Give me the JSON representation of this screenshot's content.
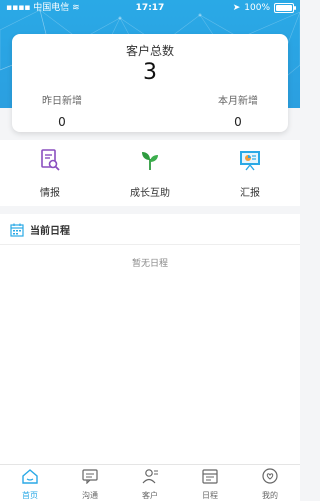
{
  "status_bar": {
    "carrier": "中国电信",
    "time": "17:17",
    "battery_percent": "100%",
    "battery_level": 1.0
  },
  "summary": {
    "total_label": "客户总数",
    "total_value": "3",
    "yesterday_label": "昨日新增",
    "yesterday_value": "0",
    "month_label": "本月新增",
    "month_value": "0"
  },
  "quick_actions": [
    {
      "label": "情报",
      "icon": "intel-search-doc-icon",
      "color": "#8a4fbf"
    },
    {
      "label": "成长互助",
      "icon": "sprout-icon",
      "color": "#2e9b3f"
    },
    {
      "label": "汇报",
      "icon": "presentation-board-icon",
      "color": "#2aa9e6"
    }
  ],
  "schedule": {
    "title": "当前日程",
    "empty_text": "暂无日程"
  },
  "tab_bar": [
    {
      "label": "首页",
      "icon": "home-icon",
      "active": true
    },
    {
      "label": "沟通",
      "icon": "chat-icon",
      "active": false
    },
    {
      "label": "客户",
      "icon": "customer-icon",
      "active": false
    },
    {
      "label": "日程",
      "icon": "calendar-icon",
      "active": false
    },
    {
      "label": "我的",
      "icon": "profile-icon",
      "active": false
    }
  ],
  "colors": {
    "primary": "#2aa9e6",
    "background": "#f4f5f7"
  }
}
